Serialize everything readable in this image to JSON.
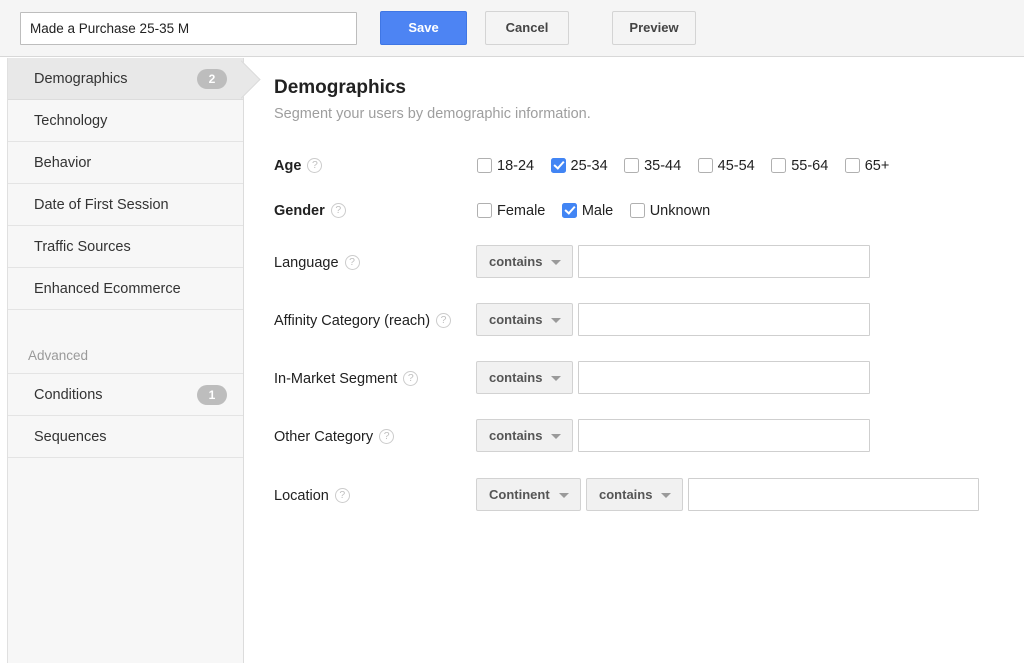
{
  "topbar": {
    "segment_name_value": "Made a Purchase 25-35 M",
    "segment_name_placeholder": "Segment Name",
    "save_label": "Save",
    "cancel_label": "Cancel",
    "preview_label": "Preview",
    "save_color": "#4d84f3"
  },
  "sidebar": {
    "items": [
      {
        "label": "Demographics",
        "badge": "2",
        "active": true
      },
      {
        "label": "Technology",
        "badge": "",
        "active": false
      },
      {
        "label": "Behavior",
        "badge": "",
        "active": false
      },
      {
        "label": "Date of First Session",
        "badge": "",
        "active": false
      },
      {
        "label": "Traffic Sources",
        "badge": "",
        "active": false
      },
      {
        "label": "Enhanced Ecommerce",
        "badge": "",
        "active": false
      }
    ],
    "section_label": "Advanced",
    "advanced_items": [
      {
        "label": "Conditions",
        "badge": "1",
        "active": false
      },
      {
        "label": "Sequences",
        "badge": "",
        "active": false
      }
    ]
  },
  "main": {
    "title": "Demographics",
    "subtitle": "Segment your users by demographic information.",
    "help_icon": "?",
    "age": {
      "label": "Age",
      "options": [
        {
          "label": "18-24",
          "checked": false
        },
        {
          "label": "25-34",
          "checked": true
        },
        {
          "label": "35-44",
          "checked": false
        },
        {
          "label": "45-54",
          "checked": false
        },
        {
          "label": "55-64",
          "checked": false
        },
        {
          "label": "65+",
          "checked": false
        }
      ]
    },
    "gender": {
      "label": "Gender",
      "options": [
        {
          "label": "Female",
          "checked": false
        },
        {
          "label": "Male",
          "checked": true
        },
        {
          "label": "Unknown",
          "checked": false
        }
      ]
    },
    "language": {
      "label": "Language",
      "match": "contains",
      "value": "",
      "placeholder": ""
    },
    "affinity": {
      "label": "Affinity Category (reach)",
      "match": "contains",
      "value": "",
      "placeholder": ""
    },
    "inmarket": {
      "label": "In-Market Segment",
      "match": "contains",
      "value": "",
      "placeholder": ""
    },
    "other_category": {
      "label": "Other Category",
      "match": "contains",
      "value": "",
      "placeholder": ""
    },
    "location": {
      "label": "Location",
      "scope": "Continent",
      "match": "contains",
      "value": "",
      "placeholder": ""
    },
    "checkbox_accent": "#4285f4"
  }
}
